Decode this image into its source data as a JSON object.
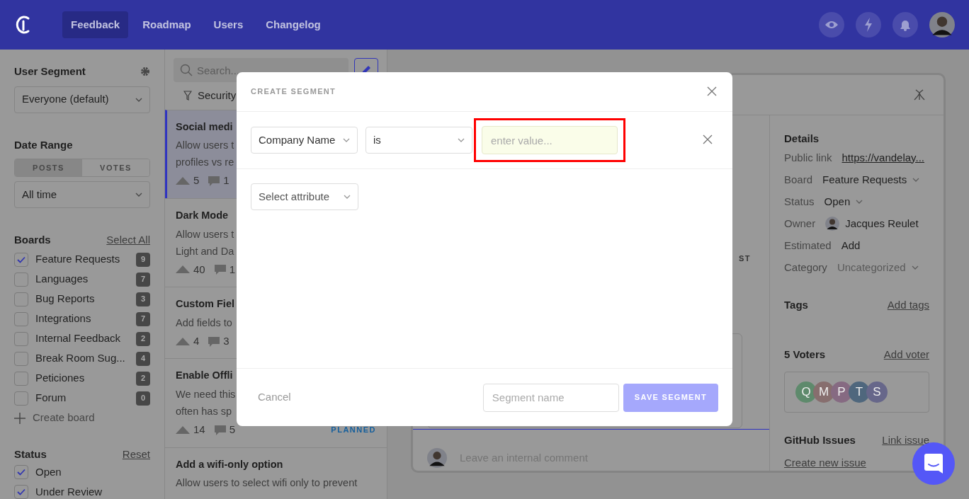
{
  "navbar": {
    "items": [
      {
        "label": "Feedback",
        "selected": true
      },
      {
        "label": "Roadmap",
        "selected": false
      },
      {
        "label": "Users",
        "selected": false
      },
      {
        "label": "Changelog",
        "selected": false
      }
    ]
  },
  "sidebar": {
    "user_segment": {
      "title": "User Segment",
      "value": "Everyone (default)"
    },
    "date_range": {
      "title": "Date Range",
      "tabs": [
        {
          "label": "POSTS",
          "selected": true
        },
        {
          "label": "VOTES",
          "selected": false
        }
      ],
      "value": "All time"
    },
    "boards": {
      "title": "Boards",
      "action": "Select All",
      "items": [
        {
          "label": "Feature Requests",
          "count": "9",
          "checked": true
        },
        {
          "label": "Languages",
          "count": "7",
          "checked": false
        },
        {
          "label": "Bug Reports",
          "count": "3",
          "checked": false
        },
        {
          "label": "Integrations",
          "count": "7",
          "checked": false
        },
        {
          "label": "Internal Feedback",
          "count": "2",
          "checked": false
        },
        {
          "label": "Break Room Sug...",
          "count": "4",
          "checked": false
        },
        {
          "label": "Peticiones",
          "count": "2",
          "checked": false
        },
        {
          "label": "Forum",
          "count": "0",
          "checked": false
        }
      ],
      "create": "Create board"
    },
    "status": {
      "title": "Status",
      "action": "Reset",
      "items": [
        {
          "label": "Open",
          "checked": true
        },
        {
          "label": "Under Review",
          "checked": true
        }
      ]
    }
  },
  "post_list": {
    "search_placeholder": "Search...",
    "filter": "Security",
    "posts": [
      {
        "title": "Social medi",
        "excerpt": [
          "Allow users t",
          "profiles vs re"
        ],
        "votes": "5",
        "comments": "1",
        "selected": true
      },
      {
        "title": "Dark Mode",
        "excerpt": [
          "Allow users t",
          "Light and Da"
        ],
        "votes": "40",
        "comments": "1",
        "selected": false
      },
      {
        "title": "Custom Fiel",
        "excerpt": [
          "Add fields to"
        ],
        "votes": "4",
        "comments": "3",
        "selected": false
      },
      {
        "title": "Enable Offli",
        "excerpt": [
          "We need this",
          "often has sp"
        ],
        "votes": "14",
        "comments": "5",
        "status": "PLANNED",
        "selected": false
      },
      {
        "title": "Add a wifi-only option",
        "excerpt": [
          "Allow users to select wifi only to prevent"
        ],
        "selected": false
      }
    ]
  },
  "post_detail": {
    "partial_label": "ST",
    "comment_placeholder": "Leave an internal comment",
    "details": {
      "title": "Details",
      "rows": [
        {
          "kind": "link",
          "label": "Public link",
          "value": "https://vandelay..."
        },
        {
          "kind": "dropdown",
          "label": "Board",
          "value": "Feature Requests"
        },
        {
          "kind": "dropdown",
          "label": "Status",
          "value": "Open"
        },
        {
          "kind": "user",
          "label": "Owner",
          "value": "Jacques Reulet"
        },
        {
          "kind": "text",
          "label": "Estimated",
          "value": "Add"
        },
        {
          "kind": "muted_dropdown",
          "label": "Category",
          "value": "Uncategorized"
        }
      ]
    },
    "tags": {
      "title": "Tags",
      "action": "Add tags"
    },
    "voters": {
      "title": "5 Voters",
      "action": "Add voter",
      "avatars": [
        {
          "letter": "Q",
          "color": "#5e8a6c"
        },
        {
          "letter": "M",
          "color": "#876e6e"
        },
        {
          "letter": "P",
          "color": "#866a82"
        },
        {
          "letter": "T",
          "color": "#4f677d"
        },
        {
          "letter": "S",
          "color": "#67678a"
        }
      ]
    },
    "github": {
      "title": "GitHub Issues",
      "action": "Link issue",
      "create": "Create new issue"
    }
  },
  "modal": {
    "title": "CREATE SEGMENT",
    "conditions": [
      {
        "attribute": "Company Name",
        "operator": "is",
        "value_placeholder": "enter value...",
        "highlighted": true
      }
    ],
    "add_attribute": "Select attribute",
    "cancel": "Cancel",
    "name_placeholder": "Segment name",
    "save": "SAVE SEGMENT",
    "save_disabled": true
  }
}
